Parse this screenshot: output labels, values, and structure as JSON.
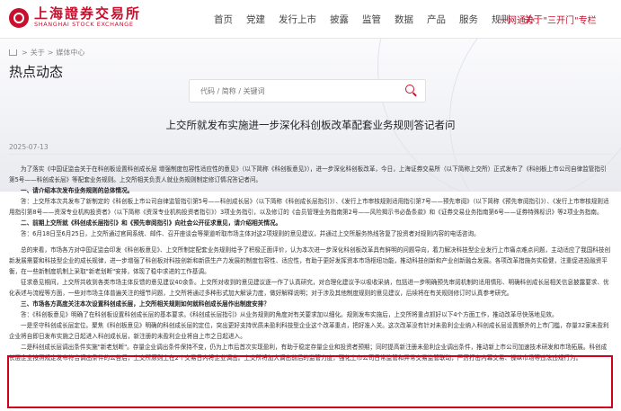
{
  "header": {
    "logo_cn": "上海證券交易所",
    "logo_en": "SHANGHAI STOCK EXCHANGE",
    "nav": [
      "首页",
      "党建",
      "发行上市",
      "披露",
      "监管",
      "数据",
      "产品",
      "服务",
      "规则",
      "关于"
    ],
    "active_nav": "关于",
    "promo_left": "一网通办",
    "promo_right": "\"三开门\"专栏"
  },
  "banner": {
    "breadcrumb": [
      "关于",
      "媒体中心"
    ],
    "title": "热点动态",
    "search_placeholder": "代码 / 简称 / 关键词"
  },
  "article": {
    "title": "上交所就发布实施进一步深化科创板改革配套业务规则答记者问",
    "date": "2025-07-13",
    "paragraphs": [
      {
        "type": "p",
        "text": "为了落实《中国证监会关于在科创板设置科创成长层 增强制度包容性适应性的意见》（以下简称《科创板意见》），进一步深化科创板改革，今日，上海证券交易所（以下简称上交所）正式发布了《科创板上市公司自律监管指引第5号——科创成长层》等配套业务规则。上交所相关负责人就业务规则制定修订情况答记者问。"
      },
      {
        "type": "h",
        "text": "一、请介绍本次发布业务规则的总体情况。"
      },
      {
        "type": "p",
        "text": "答：上交所本次共发布了新制定的《科创板上市公司自律监管指引第5号——科创成长层》（以下简称《科创成长层指引》）、《发行上市审核规则适用指引第7号——预先审阅》（以下简称《预先审阅指引》）、《发行上市审核规则适用指引第8号——资深专业机构投资者》（以下简称《资深专业机构投资者指引》）3项业务指引，以及修订的《会员管理业务指南第2号——风险揭示书必备条款》和《证券交易业务指南第6号——证券特殊标识》等2项业务指南。"
      },
      {
        "type": "h",
        "text": "二、前期上交所就《科创成长层指引》和《预先审阅指引》向社会公开征求意见，请介绍相关情况。"
      },
      {
        "type": "p",
        "cls": "gap",
        "text": "答：6月18日至6月25日，上交所通过官网系统、邮件、召开座谈会等渠道听取市场主体对这2项规则的意见建议，并通过上交所服务热线答复了投资者对规则内容的电话咨询。"
      },
      {
        "type": "p",
        "text": "总的来看，市场各方对中国证监会印发《科创板意见》、上交所制定配套业务规则给予了积极正面评价，认为本次进一步深化科创板改革具有鲜明的问题导向，着力解决科技型企业发行上市痛点难点问题，主动适应了我国科技创新发展需要和科技型企业的成长规律，进一步增强了科创板对科技创新和新质生产力发展的制度包容性、适应性，有助于更好发挥资本市场枢纽功能，推动科技创新和产业创新融合发展。各项改革措施务实稳健，注重促进投融资平衡，在一些新制度机制上采取\"新老划断\"安排，体现了稳中求进的工作基调。"
      },
      {
        "type": "p",
        "text": "征求意见期间，上交所共收到各类市场主体反馈的意见建议40余条。上交所对收到的意见建议逐一作了认真研究，对合理化建议予以吸收采纳，包括进一步明确预先审阅机制的适用情形、明确科创成长层相关信息披露要求、优化表述与流程等方面，一些对市场主体普遍关注的细节问题，上交所将通过多种形式加大解读力度，做好解释说明；对于涉及其他制度规则的意见建议，后续将在有关规则修订时认真参考研究。"
      },
      {
        "type": "h",
        "text": "三、市场各方高度关注本次设置科创成长层，上交所相关规则如何就科创成长层作出制度安排？"
      },
      {
        "type": "p",
        "text": "答：《科创板意见》明确了在科创板设置科创成长层的基本要求。《科创成长层指引》从业务规则的角度对有关要求加以细化。规则发布实施后，上交所将重点抓好以下4个方面工作，推动改革尽快落地见效。"
      },
      {
        "type": "p",
        "text": "一是坚守科创成长层定位。聚焦《科创板意见》明确的科创成长层的定位，突出更好支持优质未盈利科技型企业这个改革重点，把好准入关。这次改革没有针对未盈利企业纳入科创成长层设置额外的上市门槛，存量32家未盈利企业将自即日发布实施之日起进入科创成长层，新注册的未盈利企业将自上市之日起进入。"
      },
      {
        "type": "p",
        "text": "二是科创成长层调出条件实施\"新老划断\"。存量企业调出条件保持不变，仍为上市后首次实现盈利，有助于稳定存量企业和投资者预期；同时提高新注册未盈利企业调出条件，推动新上市公司加速技术研发和市场拓展。科创成长层企业按照规定发布符合调出条件的公告后，上交所原则上在2个交易日内将企业调出。上交所将加大调出前后的监管力度，强化上市公司日常监管和异常交易监管联动，严厉打击内幕交易、操纵市场等违法违规行为。"
      }
    ]
  }
}
